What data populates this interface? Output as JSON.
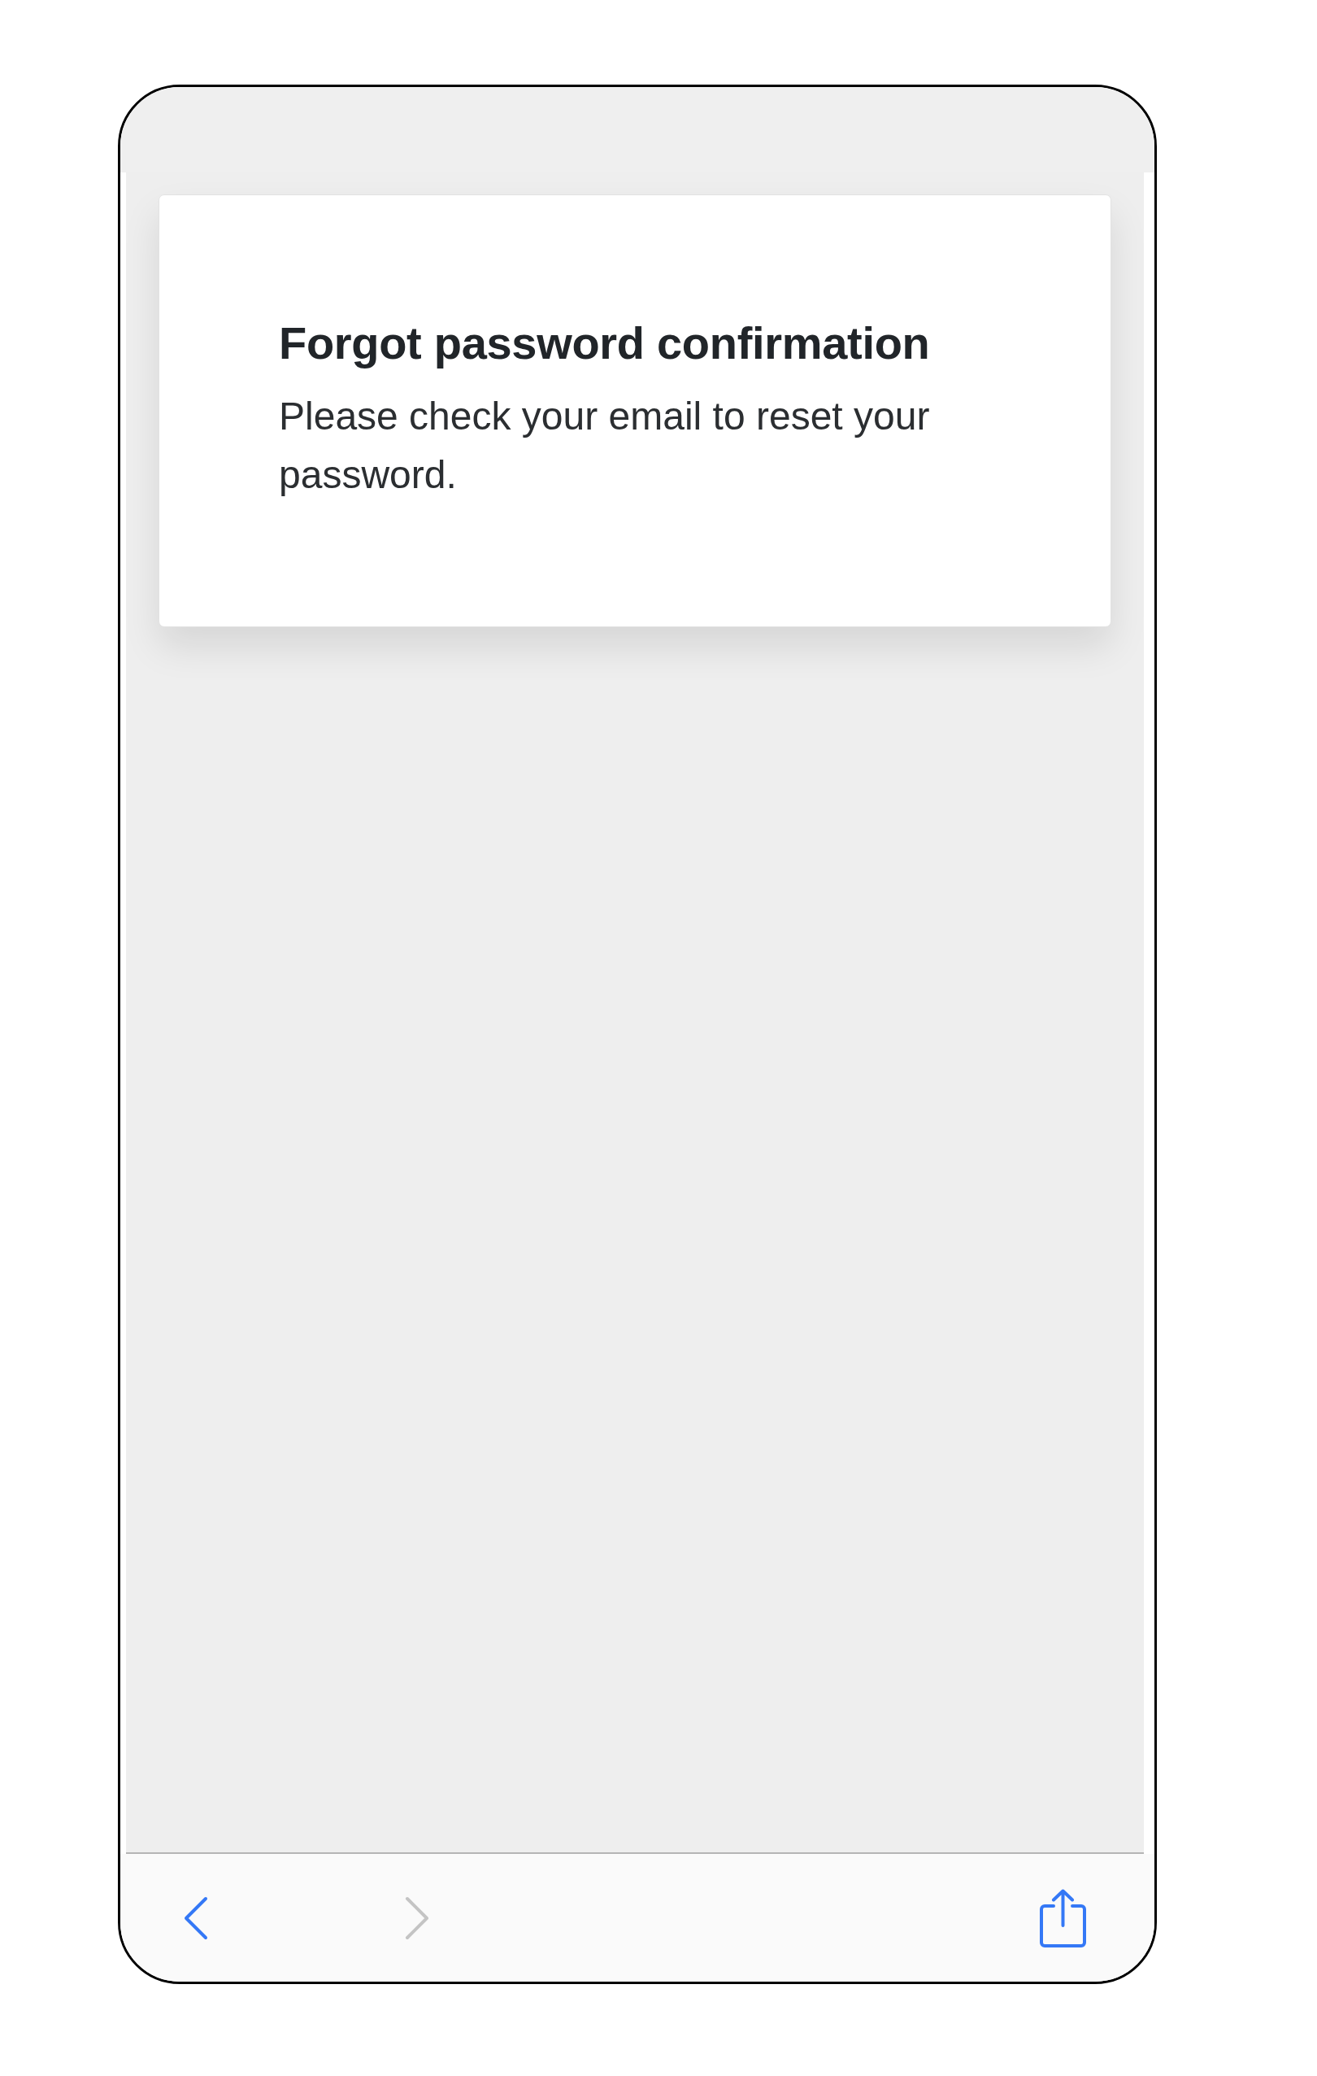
{
  "card": {
    "title": "Forgot password confirmation",
    "message": "Please check your email to reset your password."
  },
  "toolbar": {
    "buttons": [
      {
        "kind": "back",
        "disabled": false
      },
      {
        "kind": "forward",
        "disabled": true
      },
      {
        "kind": "share",
        "disabled": false
      }
    ]
  }
}
